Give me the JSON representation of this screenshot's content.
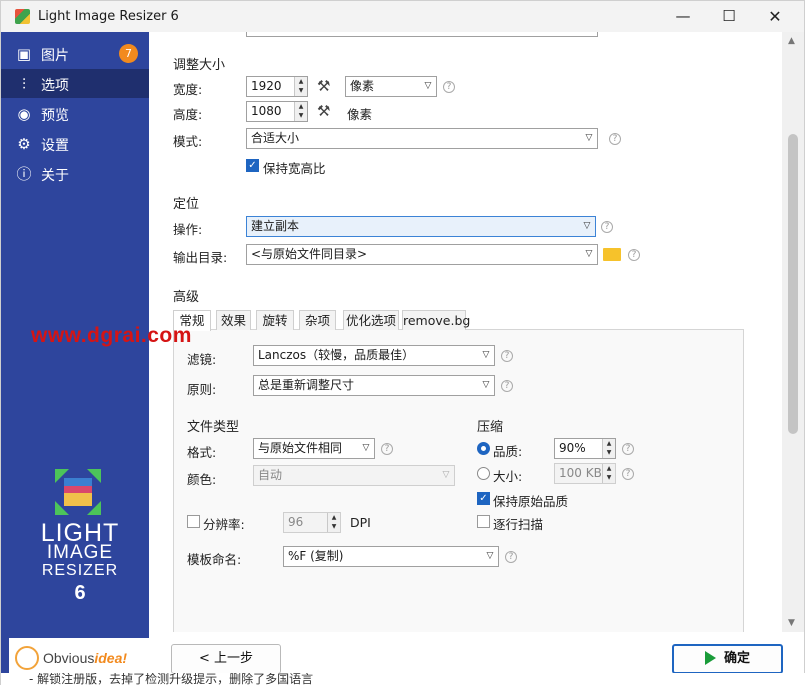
{
  "window": {
    "title": "Light Image Resizer 6",
    "minimize": "—",
    "maximize": "☐",
    "close": "✕"
  },
  "sidebar": {
    "items": [
      {
        "label": "图片",
        "icon": "pictures-icon",
        "badge": "7"
      },
      {
        "label": "选项",
        "icon": "options-sliders-icon",
        "active": true
      },
      {
        "label": "预览",
        "icon": "eye-icon"
      },
      {
        "label": "设置",
        "icon": "gear-icon"
      },
      {
        "label": "关于",
        "icon": "info-icon"
      }
    ],
    "brand": {
      "line1": "LIGHT",
      "line2": "IMAGE",
      "line3": "RESIZER",
      "line4": "6"
    },
    "vendor": {
      "prefix": "Obvious",
      "suffix": "idea!"
    }
  },
  "resize": {
    "title": "调整大小",
    "width_label": "宽度:",
    "width_value": "1920",
    "unit_value": "像素",
    "height_label": "高度:",
    "height_value": "1080",
    "height_unit": "像素",
    "mode_label": "模式:",
    "mode_value": "合适大小",
    "keep_ratio_label": "保持宽高比",
    "keep_ratio_checked": true
  },
  "location": {
    "title": "定位",
    "action_label": "操作:",
    "action_value": "建立副本",
    "output_label": "输出目录:",
    "output_value": "<与原始文件同目录>"
  },
  "advanced": {
    "title": "高级",
    "tabs": [
      "常规",
      "效果",
      "旋转",
      "杂项",
      "优化选项",
      "remove.bg"
    ],
    "active_tab": "常规",
    "filter_label": "滤镜:",
    "filter_value": "Lanczos（较慢，品质最佳）",
    "rule_label": "原则:",
    "rule_value": "总是重新调整尺寸",
    "filetype_title": "文件类型",
    "format_label": "格式:",
    "format_value": "与原始文件相同",
    "color_label": "颜色:",
    "color_value": "自动",
    "resolution_label": "分辨率:",
    "resolution_value": "96",
    "resolution_unit": "DPI",
    "template_label": "模板命名:",
    "template_value": "%F (复制)",
    "compress_title": "压缩",
    "quality_label": "品质:",
    "quality_value": "90%",
    "size_label": "大小:",
    "size_value": "100 KB",
    "keep_quality_label": "保持原始品质",
    "progressive_label": "逐行扫描"
  },
  "footer": {
    "back_label": "< 上一步",
    "ok_label": "确定"
  },
  "watermark": "www.dgrai.com",
  "bottom_text": "- 解锁注册版，去掉了检测升级提示，删除了多国语言",
  "colors": {
    "sidebar": "#2e459d",
    "sidebar_active": "#1f2f6e",
    "accent": "#1e65c1",
    "badge": "#f28a1e",
    "ok_icon": "#1a9c3a"
  }
}
